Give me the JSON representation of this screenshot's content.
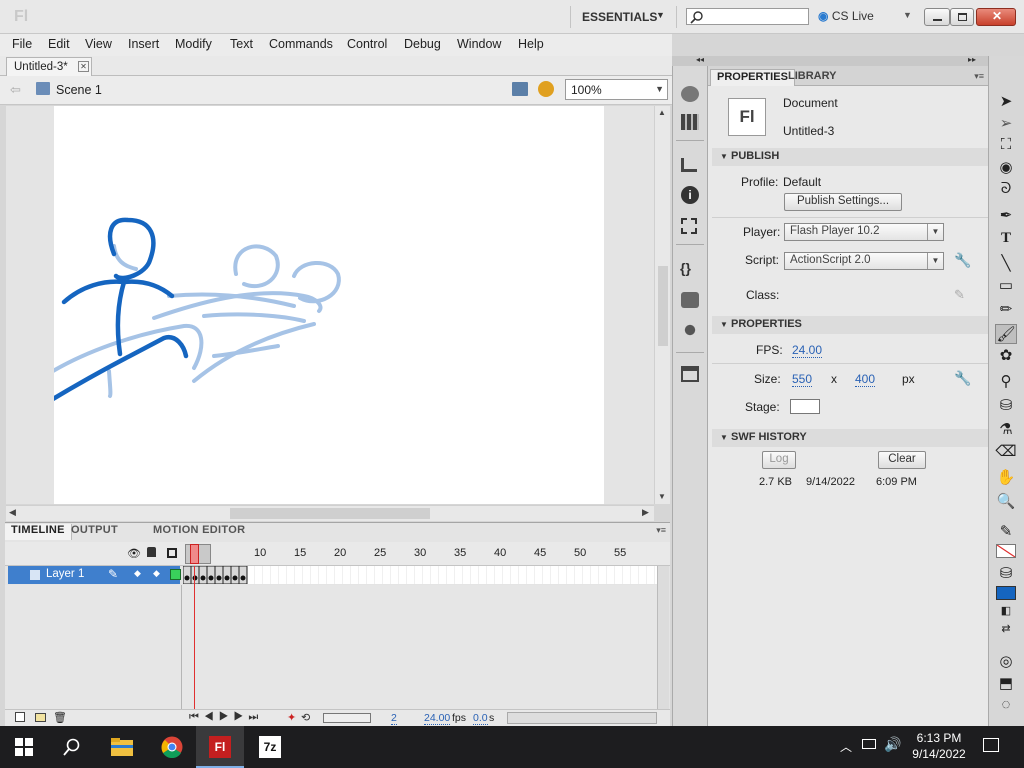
{
  "app": {
    "logo": "Fl"
  },
  "titlebar": {
    "workspace": "ESSENTIALS",
    "cs_live": "CS Live"
  },
  "menu": [
    "File",
    "Edit",
    "View",
    "Insert",
    "Modify",
    "Text",
    "Commands",
    "Control",
    "Debug",
    "Window",
    "Help"
  ],
  "document": {
    "tab_label": "Untitled-3*",
    "scene": "Scene 1",
    "zoom": "100%"
  },
  "timeline": {
    "tabs": [
      "TIMELINE",
      "OUTPUT",
      "MOTION EDITOR"
    ],
    "frame_numbers": [
      "10",
      "15",
      "20",
      "25",
      "30",
      "35",
      "40",
      "45",
      "50",
      "55"
    ],
    "layer_name": "Layer 1",
    "current_frame": "2",
    "fps": "24.00",
    "fps_unit": "fps",
    "elapsed": "0.0",
    "elapsed_unit": "s"
  },
  "properties": {
    "tabs": [
      "PROPERTIES",
      "LIBRARY"
    ],
    "doc_icon": "Fl",
    "doc_type": "Document",
    "doc_name": "Untitled-3",
    "publish_header": "PUBLISH",
    "profile_label": "Profile:",
    "profile_value": "Default",
    "publish_settings": "Publish Settings...",
    "player_label": "Player:",
    "player_value": "Flash Player 10.2",
    "script_label": "Script:",
    "script_value": "ActionScript 2.0",
    "class_label": "Class:",
    "props_header": "PROPERTIES",
    "fps_label": "FPS:",
    "fps_value": "24.00",
    "size_label": "Size:",
    "width": "550",
    "x_sep": "x",
    "height": "400",
    "unit": "px",
    "stage_label": "Stage:",
    "stage_color": "#ffffff",
    "swf_header": "SWF HISTORY",
    "log_button": "Log",
    "clear_button": "Clear",
    "history": {
      "size": "2.7 KB",
      "date": "9/14/2022",
      "time": "6:09 PM"
    }
  },
  "taskbar": {
    "time": "6:13 PM",
    "date": "9/14/2022"
  },
  "colors": {
    "accent": "#3f7fcd",
    "stroke_dark": "#1565c0",
    "stroke_onion": "#90b4de",
    "playhead": "#e03030"
  },
  "icons": [
    "search-icon",
    "wrench-icon",
    "pencil-icon",
    "windows-start-icon",
    "explorer-icon",
    "chrome-icon",
    "flash-icon",
    "7zip-icon"
  ]
}
